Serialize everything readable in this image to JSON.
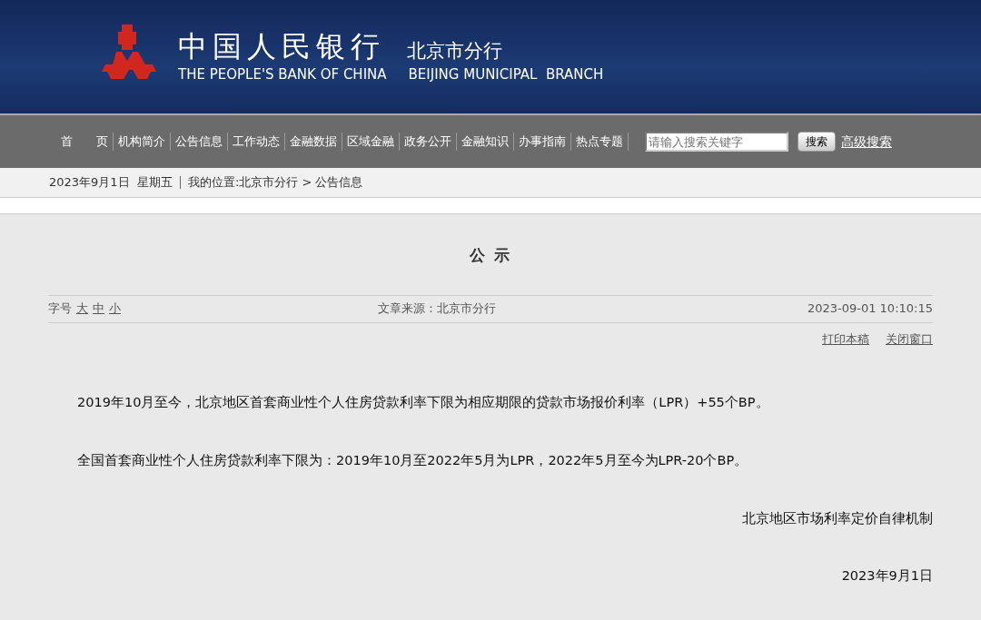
{
  "header": {
    "title_cn": "中国人民银行",
    "title_en": "THE PEOPLE'S BANK OF CHINA",
    "branch_cn": "北京市分行",
    "branch_en": "BEIJING MUNICIPAL  BRANCH"
  },
  "nav": {
    "items": [
      "首　　页",
      "机构简介",
      "公告信息",
      "工作动态",
      "金融数据",
      "区域金融",
      "政务公开",
      "金融知识",
      "办事指南",
      "热点专题"
    ],
    "search": {
      "placeholder": "请输入搜索关键字",
      "button": "搜索",
      "advanced": "高级搜索"
    }
  },
  "breadcrumb": {
    "date": "2023年9月1日  星期五",
    "location": "我的位置:北京市分行 > 公告信息"
  },
  "article": {
    "title": "公 示",
    "font_size_label": "字号",
    "font_sizes": [
      "大",
      "中",
      "小"
    ],
    "source": "文章来源：北京市分行",
    "datetime": "2023-09-01 10:10:15",
    "actions": [
      "打印本稿",
      "关闭窗口"
    ],
    "paragraphs": [
      "2019年10月至今，北京地区首套商业性个人住房贷款利率下限为相应期限的贷款市场报价利率（LPR）+55个BP。",
      "全国首套商业性个人住房贷款利率下限为：2019年10月至2022年5月为LPR，2022年5月至今为LPR-20个BP。"
    ],
    "signature": "北京地区市场利率定价自律机制",
    "date": "2023年9月1日"
  }
}
